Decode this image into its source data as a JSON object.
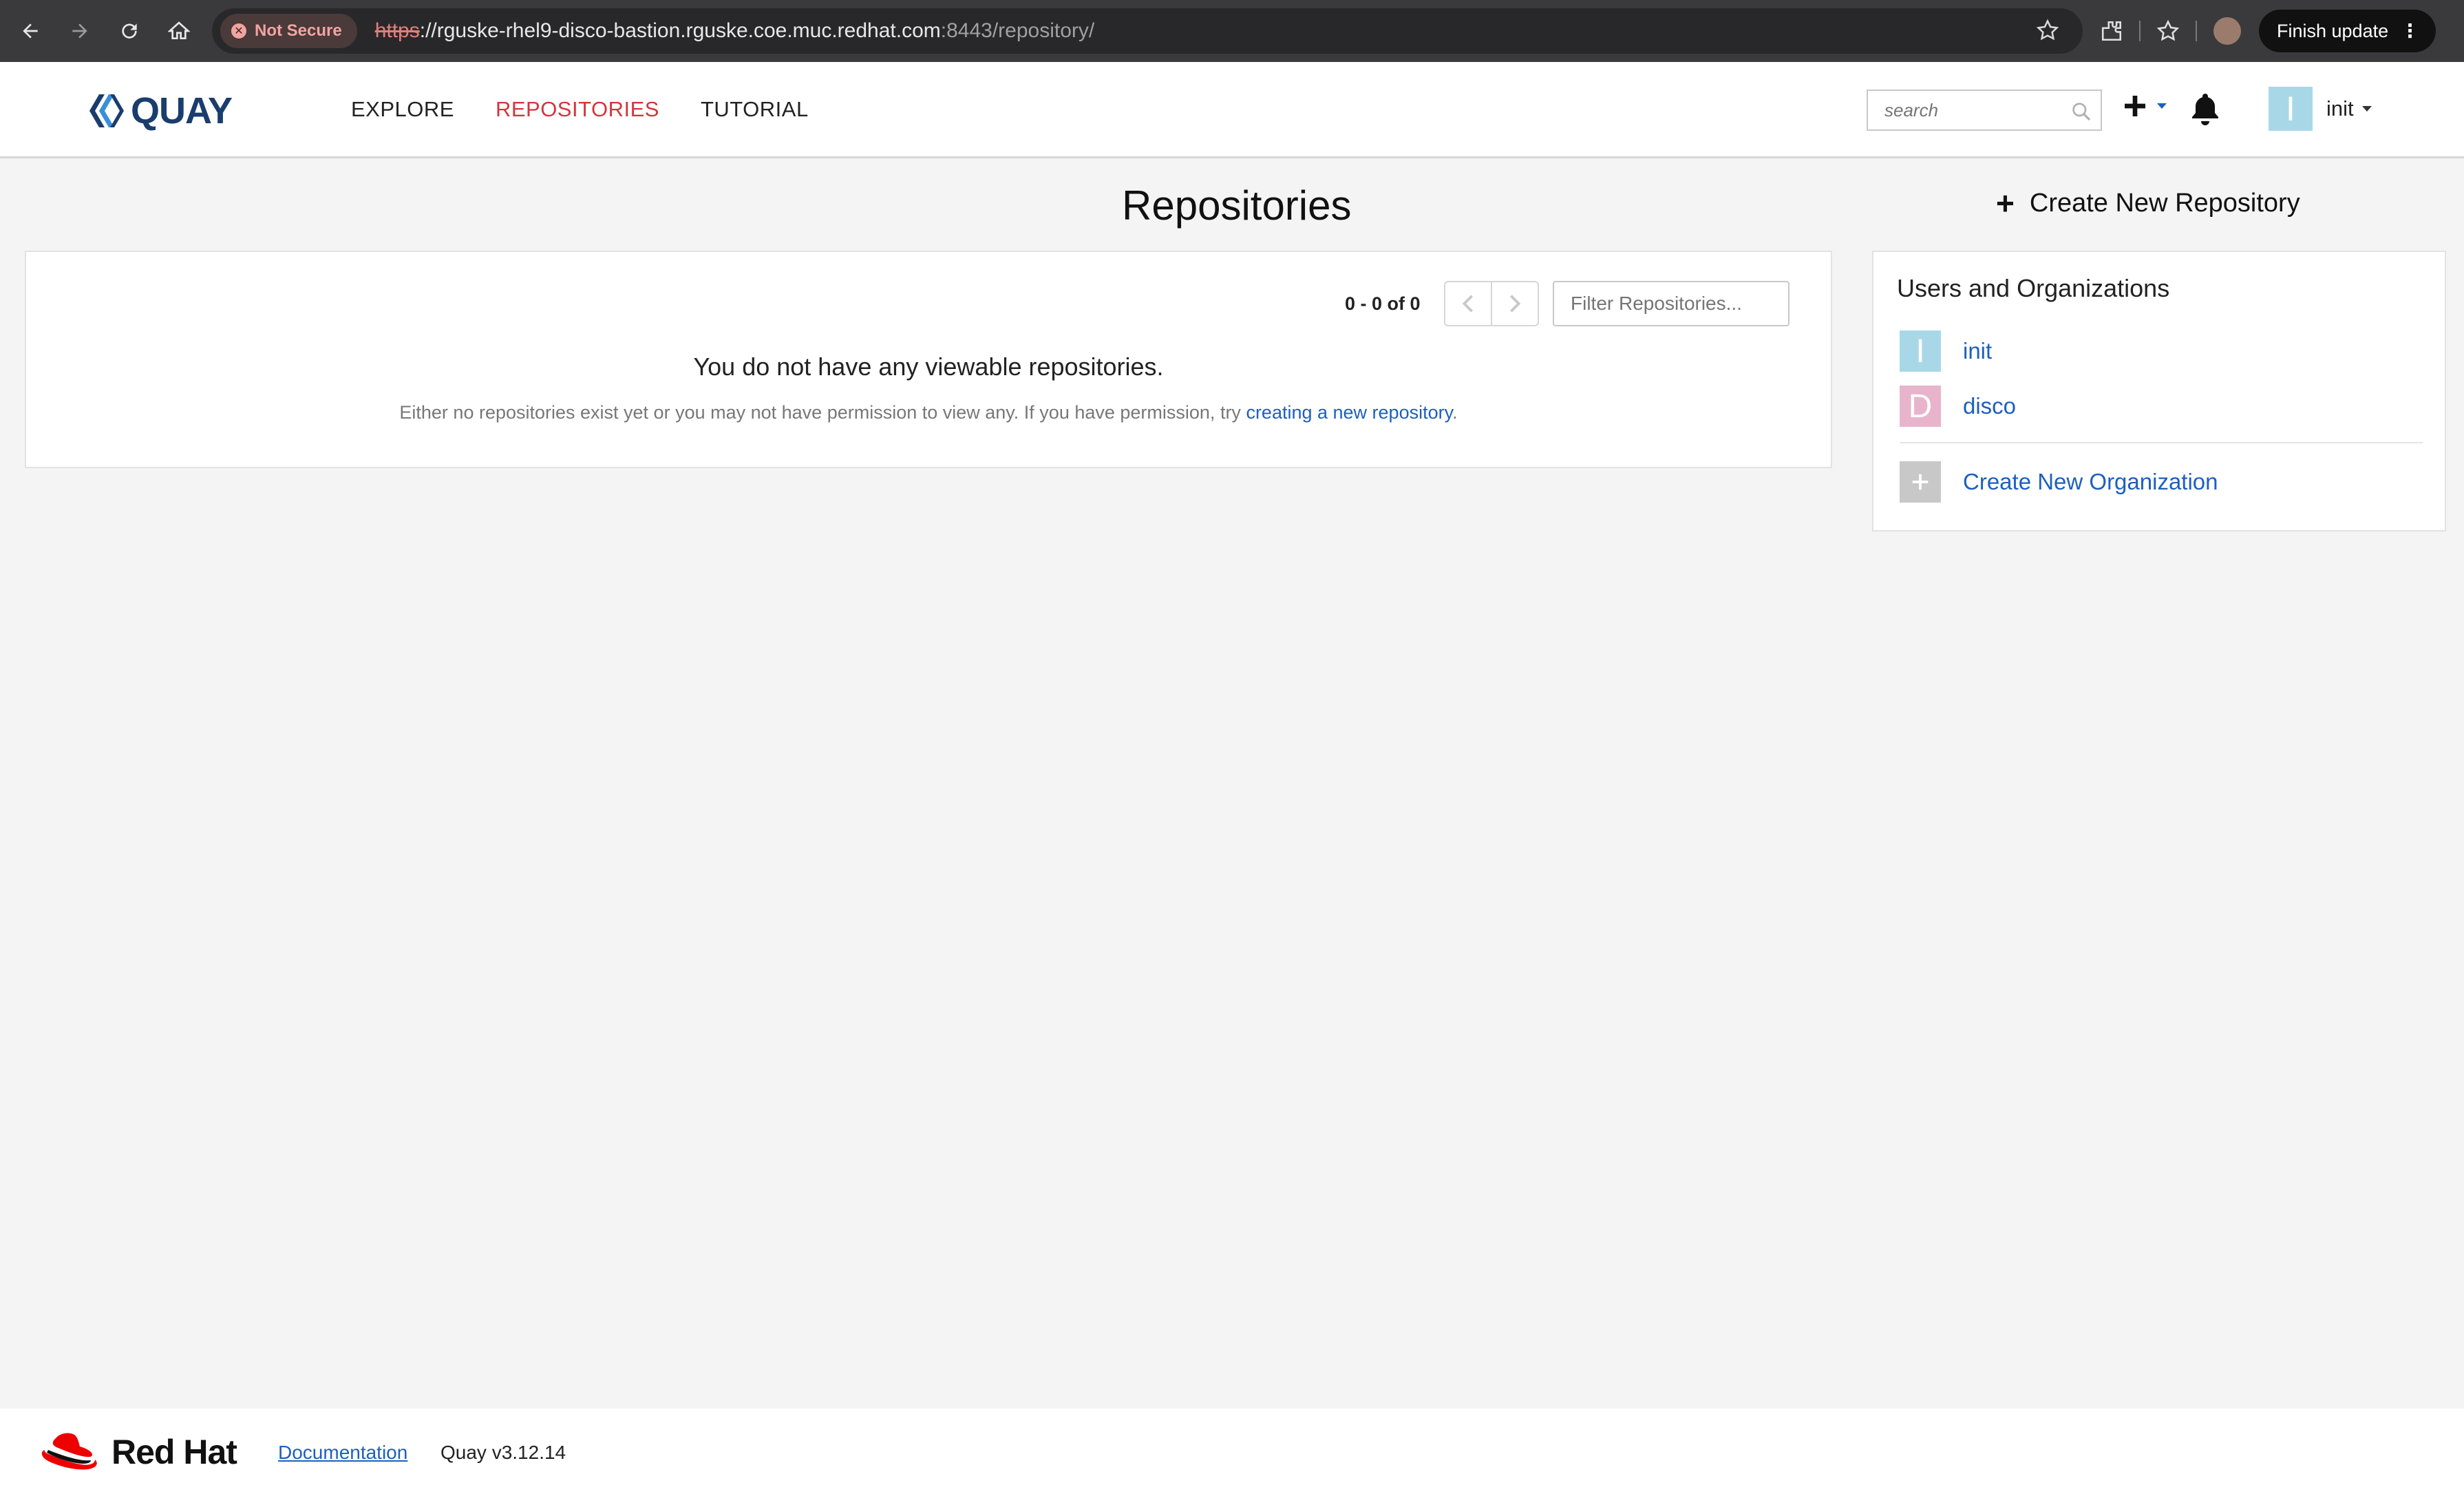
{
  "browser": {
    "security_label": "Not Secure",
    "url_scheme": "https",
    "url_host": "://rguske-rhel9-disco-bastion.rguske.coe.muc.redhat.com",
    "url_rest": ":8443/repository/",
    "finish_update": "Finish update"
  },
  "header": {
    "logo_text": "QUAY",
    "nav": [
      {
        "label": "EXPLORE",
        "active": false
      },
      {
        "label": "REPOSITORIES",
        "active": true
      },
      {
        "label": "TUTORIAL",
        "active": false
      }
    ],
    "search_placeholder": "search",
    "user_initial": "I",
    "user_name": "init"
  },
  "main": {
    "title": "Repositories",
    "create_repo_label": "Create New Repository",
    "pager_text": "0 - 0 of 0",
    "filter_placeholder": "Filter Repositories...",
    "empty_title": "You do not have any viewable repositories.",
    "empty_desc_prefix": "Either no repositories exist yet or you may not have permission to view any. If you have permission, try ",
    "empty_desc_link": "creating a new repository",
    "empty_desc_suffix": "."
  },
  "sidebar": {
    "title": "Users and Organizations",
    "orgs": [
      {
        "initial": "I",
        "name": "init",
        "color": "#a8d8e8"
      },
      {
        "initial": "D",
        "name": "disco",
        "color": "#e8b4cc"
      }
    ],
    "create_org_label": "Create New Organization",
    "create_org_icon_color": "#c8c8c8"
  },
  "footer": {
    "brand": "Red Hat",
    "documentation": "Documentation",
    "version": "Quay v3.12.14"
  },
  "colors": {
    "active_nav": "#d4353c",
    "link": "#1d5fbf",
    "logo": "#1a3d6d"
  }
}
